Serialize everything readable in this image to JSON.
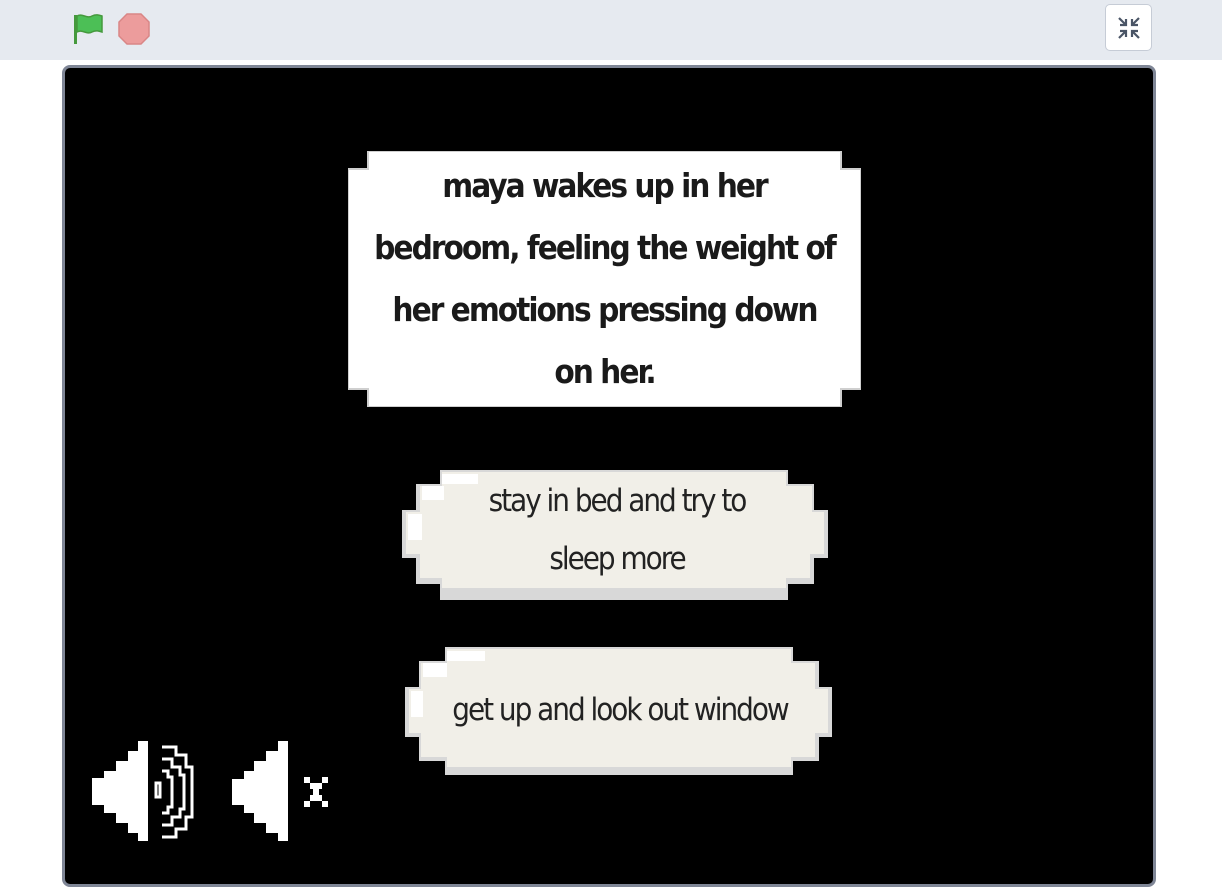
{
  "toolbar": {
    "green_flag_icon": "green-flag-icon",
    "stop_icon": "stop-icon",
    "fullscreen_exit_icon": "exit-fullscreen-icon"
  },
  "stage": {
    "narration": "maya wakes up in her bedroom, feeling the weight of her emotions pressing down on her.",
    "choices": [
      {
        "label": "stay in bed and try to sleep more"
      },
      {
        "label": "get up and look out window"
      }
    ],
    "sound_on_icon": "speaker-on-icon",
    "sound_off_icon": "speaker-mute-icon"
  },
  "colors": {
    "topbar_bg": "#e6eaf0",
    "stage_bg": "#000000",
    "stage_border": "#7f8696",
    "flag_green": "#4cbf56",
    "stop_red": "#ec9c9c",
    "narration_bg": "#ffffff",
    "choice_bg": "#f1efe8",
    "choice_shadow": "#d6d6d6"
  }
}
